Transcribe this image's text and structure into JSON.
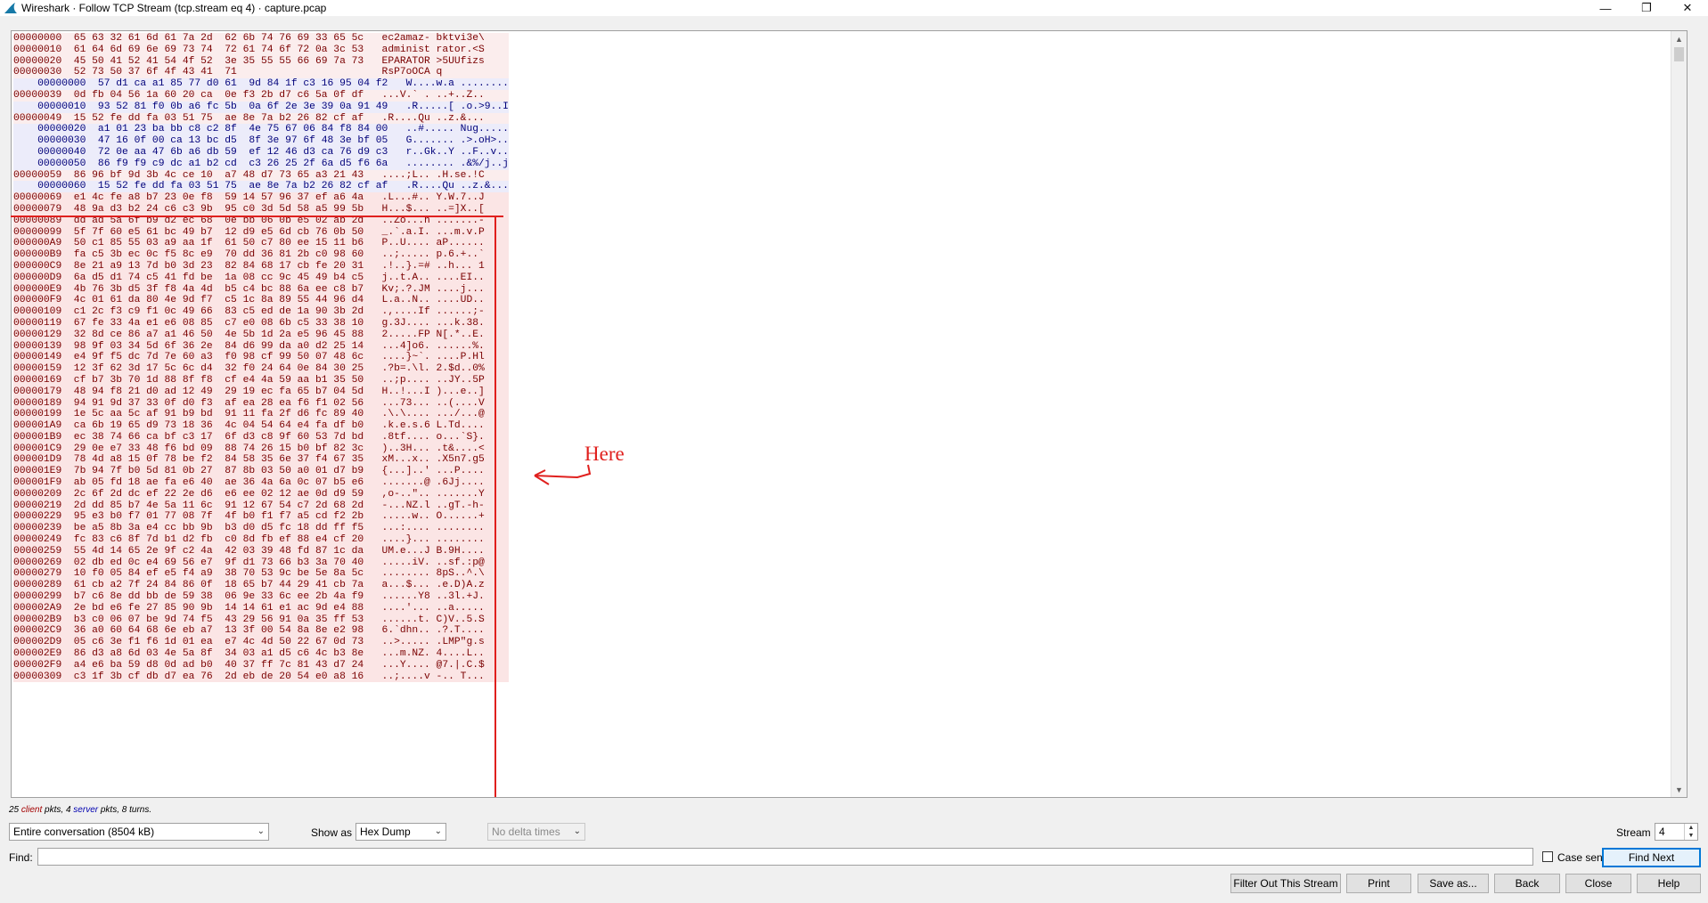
{
  "window": {
    "title": "Wireshark · Follow TCP Stream (tcp.stream eq 4) · capture.pcap",
    "minimize": "—",
    "maximize": "❐",
    "close": "✕"
  },
  "hex_lines": [
    {
      "dir": "client",
      "text": "00000000  65 63 32 61 6d 61 7a 2d  62 6b 74 76 69 33 65 5c   ec2amaz- bktvi3e\\"
    },
    {
      "dir": "client",
      "text": "00000010  61 64 6d 69 6e 69 73 74  72 61 74 6f 72 0a 3c 53   administ rator.<S"
    },
    {
      "dir": "client",
      "text": "00000020  45 50 41 52 41 54 4f 52  3e 35 55 55 66 69 7a 73   EPARATOR >5UUfizs"
    },
    {
      "dir": "client",
      "text": "00000030  52 73 50 37 6f 4f 43 41  71                        RsP7oOCA q"
    },
    {
      "dir": "server",
      "text": "    00000000  57 d1 ca a1 85 77 d0 61  9d 84 1f c3 16 95 04 f2   W....w.a ........"
    },
    {
      "dir": "client",
      "text": "00000039  0d fb 04 56 1a 60 20 ca  0e f3 2b d7 c6 5a 0f df   ...V.` . ..+..Z.."
    },
    {
      "dir": "server",
      "text": "    00000010  93 52 81 f0 0b a6 fc 5b  0a 6f 2e 3e 39 0a 91 49   .R.....[ .o.>9..I"
    },
    {
      "dir": "client",
      "text": "00000049  15 52 fe dd fa 03 51 75  ae 8e 7a b2 26 82 cf af   .R....Qu ..z.&..."
    },
    {
      "dir": "server",
      "text": "    00000020  a1 01 23 ba bb c8 c2 8f  4e 75 67 06 84 f8 84 00   ..#..... Nug....."
    },
    {
      "dir": "server",
      "text": "    00000030  47 16 0f 00 ca 13 bc d5  8f 3e 97 6f 48 3e bf 05   G....... .>.oH>.."
    },
    {
      "dir": "server",
      "text": "    00000040  72 0e aa 47 6b a6 db 59  ef 12 46 d3 ca 76 d9 c3   r..Gk..Y ..F..v.."
    },
    {
      "dir": "server",
      "text": "    00000050  86 f9 f9 c9 dc a1 b2 cd  c3 26 25 2f 6a d5 f6 6a   ........ .&%/j..j"
    },
    {
      "dir": "client",
      "text": "00000059  86 96 bf 9d 3b 4c ce 10  a7 48 d7 73 65 a3 21 43   ....;L.. .H.se.!C"
    },
    {
      "dir": "server",
      "text": "    00000060  15 52 fe dd fa 03 51 75  ae 8e 7a b2 26 82 cf af   .R....Qu ..z.&..."
    },
    {
      "dir": "client",
      "text": "00000069  e1 4c fe a8 b7 23 0e f8  59 14 57 96 37 ef a6 4a   .L...#.. Y.W.7..J"
    },
    {
      "dir": "client",
      "text": "00000079  48 9a d3 b2 24 c6 c3 9b  95 c0 3d 5d 58 a5 99 5b   H...$... ..=]X..["
    },
    {
      "dir": "client",
      "text": "00000089  dd ad 5a 6f b9 d2 ec 68  0e bb 06 0b e5 02 ab 2d   ..Zo...h .......-"
    },
    {
      "dir": "client",
      "text": "00000099  5f 7f 60 e5 61 bc 49 b7  12 d9 e5 6d cb 76 0b 50   _.`.a.I. ...m.v.P"
    },
    {
      "dir": "client",
      "text": "000000A9  50 c1 85 55 03 a9 aa 1f  61 50 c7 80 ee 15 11 b6   P..U.... aP......"
    },
    {
      "dir": "client",
      "text": "000000B9  fa c5 3b ec 0c f5 8c e9  70 dd 36 81 2b c0 98 60   ..;..... p.6.+..`"
    },
    {
      "dir": "client",
      "text": "000000C9  8e 21 a9 13 7d b0 3d 23  82 84 68 17 cb fe 20 31   .!..}.=# ..h... 1"
    },
    {
      "dir": "client",
      "text": "000000D9  6a d5 d1 74 c5 41 fd be  1a 08 cc 9c 45 49 b4 c5   j..t.A.. ....EI.."
    },
    {
      "dir": "client",
      "text": "000000E9  4b 76 3b d5 3f f8 4a 4d  b5 c4 bc 88 6a ee c8 b7   Kv;.?.JM ....j..."
    },
    {
      "dir": "client",
      "text": "000000F9  4c 01 61 da 80 4e 9d f7  c5 1c 8a 89 55 44 96 d4   L.a..N.. ....UD.."
    },
    {
      "dir": "client",
      "text": "00000109  c1 2c f3 c9 f1 0c 49 66  83 c5 ed de 1a 90 3b 2d   .,....If ......;-"
    },
    {
      "dir": "client",
      "text": "00000119  67 fe 33 4a e1 e6 08 85  c7 e0 08 6b c5 33 38 10   g.3J.... ...k.38."
    },
    {
      "dir": "client",
      "text": "00000129  32 8d ce 86 a7 a1 46 50  4e 5b 1d 2a e5 96 45 88   2.....FP N[.*..E."
    },
    {
      "dir": "client",
      "text": "00000139  98 9f 03 34 5d 6f 36 2e  84 d6 99 da a0 d2 25 14   ...4]o6. ......%."
    },
    {
      "dir": "client",
      "text": "00000149  e4 9f f5 dc 7d 7e 60 a3  f0 98 cf 99 50 07 48 6c   ....}~`. ....P.Hl"
    },
    {
      "dir": "client",
      "text": "00000159  12 3f 62 3d 17 5c 6c d4  32 f0 24 64 0e 84 30 25   .?b=.\\l. 2.$d..0%"
    },
    {
      "dir": "client",
      "text": "00000169  cf b7 3b 70 1d 88 8f f8  cf e4 4a 59 aa b1 35 50   ..;p.... ..JY..5P"
    },
    {
      "dir": "client",
      "text": "00000179  48 94 f8 21 d0 ad 12 49  29 19 ec fa 65 b7 04 5d   H..!...I )...e..]"
    },
    {
      "dir": "client",
      "text": "00000189  94 91 9d 37 33 0f d0 f3  af ea 28 ea f6 f1 02 56   ...73... ..(....V"
    },
    {
      "dir": "client",
      "text": "00000199  1e 5c aa 5c af 91 b9 bd  91 11 fa 2f d6 fc 89 40   .\\.\\.... .../...@"
    },
    {
      "dir": "client",
      "text": "000001A9  ca 6b 19 65 d9 73 18 36  4c 04 54 64 e4 fa df b0   .k.e.s.6 L.Td...."
    },
    {
      "dir": "client",
      "text": "000001B9  ec 38 74 66 ca bf c3 17  6f d3 c8 9f 60 53 7d bd   .8tf.... o...`S}."
    },
    {
      "dir": "client",
      "text": "000001C9  29 0e e7 33 48 f6 bd 09  88 74 26 15 b0 bf 82 3c   )..3H... .t&....<"
    },
    {
      "dir": "client",
      "text": "000001D9  78 4d a8 15 0f 78 be f2  84 58 35 6e 37 f4 67 35   xM...x.. .X5n7.g5"
    },
    {
      "dir": "client",
      "text": "000001E9  7b 94 7f b0 5d 81 0b 27  87 8b 03 50 a0 01 d7 b9   {...]..' ...P...."
    },
    {
      "dir": "client",
      "text": "000001F9  ab 05 fd 18 ae fa e6 40  ae 36 4a 6a 0c 07 b5 e6   .......@ .6Jj...."
    },
    {
      "dir": "client",
      "text": "00000209  2c 6f 2d dc ef 22 2e d6  e6 ee 02 12 ae 0d d9 59   ,o-..\".. .......Y"
    },
    {
      "dir": "client",
      "text": "00000219  2d dd 85 b7 4e 5a 11 6c  91 12 67 54 c7 2d 68 2d   -...NZ.l ..gT.-h-"
    },
    {
      "dir": "client",
      "text": "00000229  95 e3 b0 f7 01 77 08 7f  4f b0 f1 f7 a5 cd f2 2b   .....w.. O......+"
    },
    {
      "dir": "client",
      "text": "00000239  be a5 8b 3a e4 cc bb 9b  b3 d0 d5 fc 18 dd ff f5   ...:.... ........"
    },
    {
      "dir": "client",
      "text": "00000249  fc 83 c6 8f 7d b1 d2 fb  c0 8d fb ef 88 e4 cf 20   ....}... ........ "
    },
    {
      "dir": "client",
      "text": "00000259  55 4d 14 65 2e 9f c2 4a  42 03 39 48 fd 87 1c da   UM.e...J B.9H...."
    },
    {
      "dir": "client",
      "text": "00000269  02 db ed 0c e4 69 56 e7  9f d1 73 66 b3 3a 70 40   .....iV. ..sf.:p@"
    },
    {
      "dir": "client",
      "text": "00000279  10 f0 05 84 ef e5 f4 a9  38 70 53 9c be 5e 8a 5c   ........ 8pS..^.\\"
    },
    {
      "dir": "client",
      "text": "00000289  61 cb a2 7f 24 84 86 0f  18 65 b7 44 29 41 cb 7a   a...$... .e.D)A.z"
    },
    {
      "dir": "client",
      "text": "00000299  b7 c6 8e dd bb de 59 38  06 9e 33 6c ee 2b 4a f9   ......Y8 ..3l.+J."
    },
    {
      "dir": "client",
      "text": "000002A9  2e bd e6 fe 27 85 90 9b  14 14 61 e1 ac 9d e4 88   ....'... ..a....."
    },
    {
      "dir": "client",
      "text": "000002B9  b3 c0 06 07 be 9d 74 f5  43 29 56 91 0a 35 ff 53   ......t. C)V..5.S"
    },
    {
      "dir": "client",
      "text": "000002C9  36 a0 60 64 68 6e eb a7  13 3f 00 54 8a 8e e2 98   6.`dhn.. .?.T...."
    },
    {
      "dir": "client",
      "text": "000002D9  05 c6 3e f1 f6 1d 01 ea  e7 4c 4d 50 22 67 0d 73   ..>..... .LMP\"g.s"
    },
    {
      "dir": "client",
      "text": "000002E9  86 d3 a8 6d 03 4e 5a 8f  34 03 a1 d5 c6 4c b3 8e   ...m.NZ. 4....L.."
    },
    {
      "dir": "client",
      "text": "000002F9  a4 e6 ba 59 d8 0d ad b0  40 37 ff 7c 81 43 d7 24   ...Y.... @7.|.C.$"
    },
    {
      "dir": "client",
      "text": "00000309  c3 1f 3b cf db d7 ea 76  2d eb de 20 54 e0 a8 16   ..;....v -.. T..."
    }
  ],
  "annotation": {
    "here_label": "Here"
  },
  "summary": {
    "client_count": "25",
    "client_word": "client",
    "middle": "pkts, 4",
    "server_word": "server",
    "tail": "pkts, 8 turns."
  },
  "controls": {
    "conversation_select": "Entire conversation (8504 kB)",
    "show_as_label": "Show as",
    "show_as_value": "Hex Dump",
    "delta_select": "No delta times",
    "stream_label": "Stream",
    "stream_value": "4"
  },
  "find": {
    "label": "Find:",
    "value": "",
    "case_sensitive_label": "Case sensitive",
    "find_next": "Find Next"
  },
  "buttons": {
    "filter_out": "Filter Out This Stream",
    "print": "Print",
    "save_as": "Save as...",
    "back": "Back",
    "close": "Close",
    "help": "Help"
  },
  "colors": {
    "client_text": "#7a0000",
    "server_text": "#00007a",
    "annotation": "#e0201e"
  }
}
